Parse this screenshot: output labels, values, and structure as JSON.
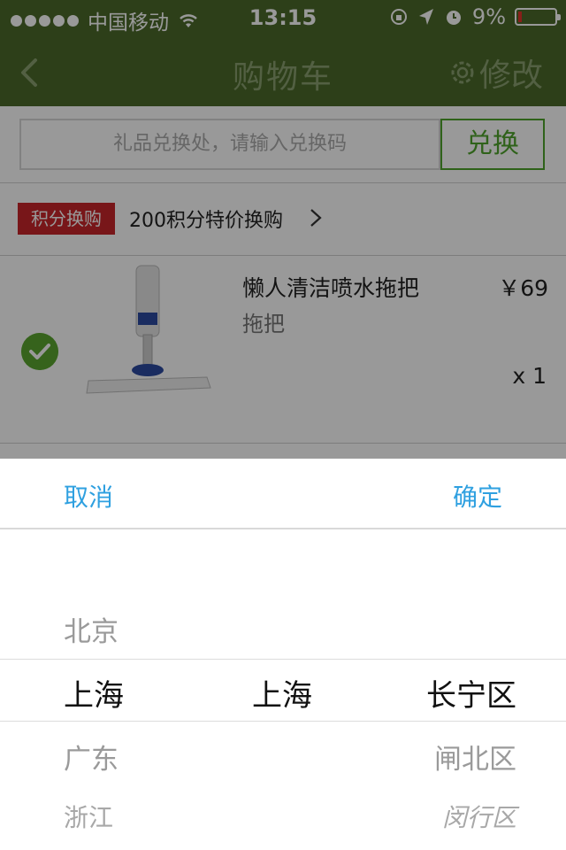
{
  "status_bar": {
    "carrier": "中国移动",
    "time": "13:15",
    "battery_percent": "9%",
    "battery_level": 0.09
  },
  "nav": {
    "title": "购物车",
    "edit_label": "修改"
  },
  "redeem": {
    "placeholder": "礼品兑换处，请输入兑换码",
    "button_label": "兑换"
  },
  "points_promo": {
    "tag": "积分换购",
    "text": "200积分特价换购"
  },
  "cart_item": {
    "name": "懒人清洁喷水拖把",
    "category": "拖把",
    "price": "￥69",
    "quantity": "x 1",
    "selected": true
  },
  "picker": {
    "cancel_label": "取消",
    "confirm_label": "确定",
    "provinces": {
      "above": "北京",
      "selected": "上海",
      "below": [
        "广东",
        "浙江"
      ]
    },
    "cities": {
      "selected": "上海"
    },
    "districts": {
      "selected": "长宁区",
      "below": [
        "闸北区",
        "闵行区"
      ]
    }
  },
  "colors": {
    "nav_bar": "#4b6a2a",
    "accent_green": "#4fa32c",
    "promo_red": "#c8252b",
    "picker_action_blue": "#2fa0e0"
  }
}
